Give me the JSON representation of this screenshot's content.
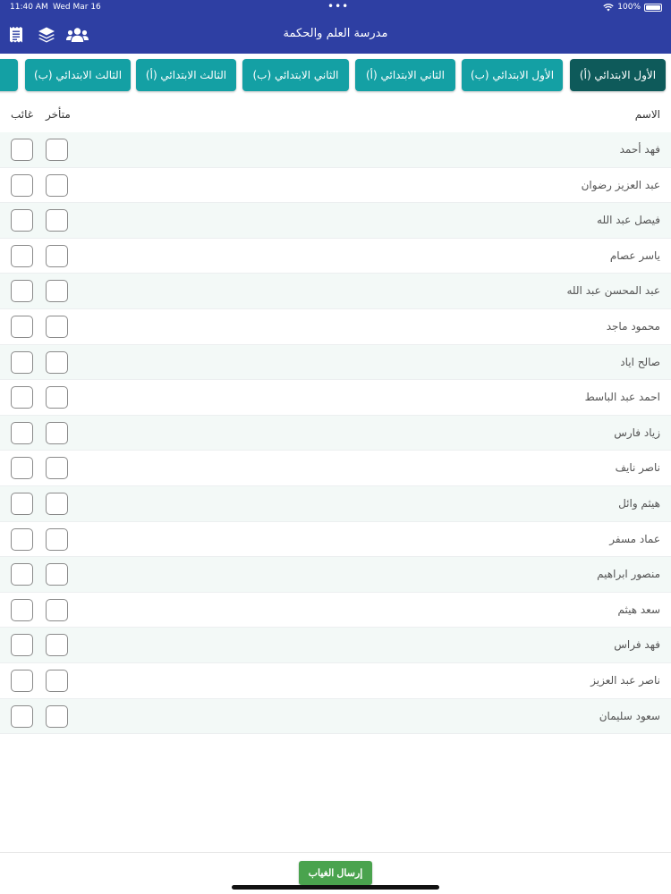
{
  "status_bar": {
    "time": "11:40 AM",
    "date": "Wed Mar 16",
    "battery": "100%"
  },
  "app_bar": {
    "title": "مدرسة العلم والحكمة",
    "icons": [
      "receipt-icon",
      "layers-icon",
      "users-icon"
    ]
  },
  "tabs": [
    {
      "label": "الأول الابتدائي (أ)",
      "active": true
    },
    {
      "label": "الأول الابتدائي (ب)",
      "active": false
    },
    {
      "label": "الثاني الابتدائي (أ)",
      "active": false
    },
    {
      "label": "الثاني الابتدائي (ب)",
      "active": false
    },
    {
      "label": "الثالث الابتدائي (أ)",
      "active": false
    },
    {
      "label": "الثالث الابتدائي (ب)",
      "active": false
    }
  ],
  "table": {
    "headers": {
      "name": "الاسم",
      "late": "متأخر",
      "absent": "غائب"
    },
    "students": [
      "فهد أحمد",
      "عبد العزيز رضوان",
      "فيصل عبد الله",
      "ياسر عصام",
      "عبد المحسن عبد الله",
      "محمود ماجد",
      "صالح اياد",
      "احمد عبد الباسط",
      "زياد فارس",
      "ناصر نايف",
      "هيثم وائل",
      "عماد مسفر",
      "منصور ابراهيم",
      "سعد هيثم",
      "فهد فراس",
      "ناصر عبد العزيز",
      "سعود سليمان"
    ]
  },
  "footer": {
    "send_label": "إرسال الغياب"
  },
  "colors": {
    "app_bar": "#2e3fa3",
    "tab": "#14a0a4",
    "tab_active": "#0e5a5a",
    "send": "#4aa34e",
    "row_alt": "#f3f9f7"
  }
}
